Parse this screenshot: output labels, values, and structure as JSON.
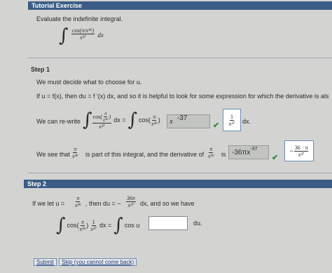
{
  "header": {
    "title": "Tutorial Exercise"
  },
  "intro": {
    "text": "Evaluate the indefinite integral.",
    "num": "cos(π/x³⁶)",
    "den": "x³⁷",
    "dx": "dx"
  },
  "step1": {
    "label": "Step 1",
    "line1": "We must decide what to choose for u.",
    "line2": "If  u = f(x),  then  du = f ′(x) dx,  and so it is helpful to look for some expression for which the derivative is als",
    "rewrite_prefix": "We can re-write",
    "cos_label": "cos",
    "pi": "π",
    "x36": "x³⁶",
    "x37": "x³⁷",
    "dx_eq": "dx =",
    "answer1_value": "x⁻³⁷",
    "answer1_raw": "-37",
    "frac_one": "1",
    "dx_end": "dx.",
    "see_prefix": "We see that",
    "see_middle": "is part of this integral, and the derivative of",
    "is": "is",
    "answer2_value": "−36πx⁻³⁷",
    "answer2_main": "-36πx",
    "answer2_exp": "-37",
    "correct_num": "36 · π",
    "correct_den": "x³⁷"
  },
  "step2": {
    "label": "Step 2",
    "if_we_let": "If we let  u =",
    "then_du": ",   then  du = −",
    "du_num": "36π",
    "du_den": "x³⁷",
    "have": "dx,  and so we have",
    "cos_u": "cos u",
    "du_end": "du.",
    "input_value": ""
  },
  "buttons": {
    "submit": "Submit",
    "skip": "Skip (you cannot come back)"
  },
  "colors": {
    "header_bar": "#3b5c86",
    "check": "#2f8a3b"
  }
}
